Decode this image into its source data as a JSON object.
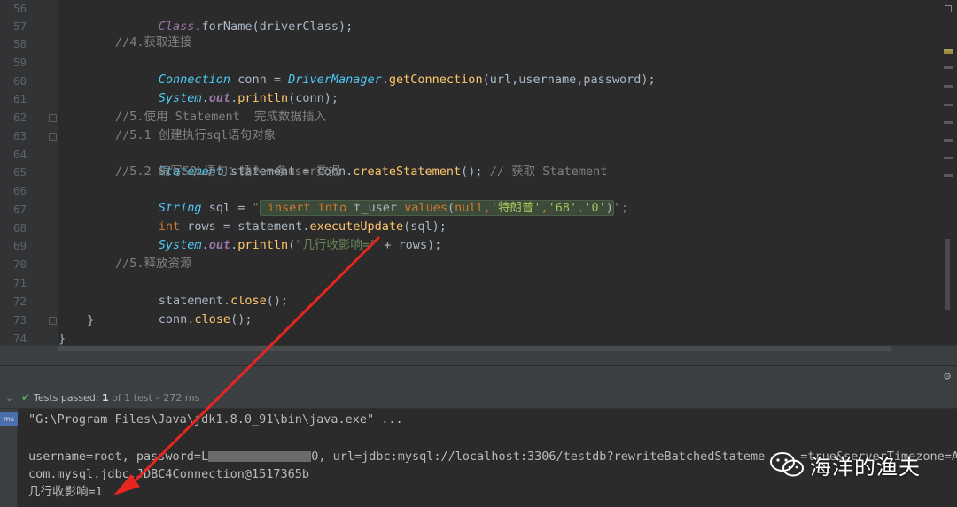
{
  "editor": {
    "line_numbers": [
      "56",
      "57",
      "58",
      "59",
      "60",
      "61",
      "62",
      "63",
      "64",
      "65",
      "66",
      "67",
      "68",
      "69",
      "70",
      "71",
      "72",
      "73",
      "74"
    ],
    "code": {
      "l56": {
        "cls": "Class",
        "rest": ".forName(driverClass);"
      },
      "l58": "//4.获取连接",
      "l59": {
        "type": "Connection",
        "var": " conn = ",
        "type2": "DriverManager",
        "dot": ".",
        "method": "getConnection",
        "args": "(url,username,password);"
      },
      "l60": {
        "cls": "System",
        "dot": ".",
        "field": "out",
        "dot2": ".",
        "method": "println",
        "args": "(conn);"
      },
      "l62": "//5.使用 Statement  完成数据插入",
      "l63": "//5.1 创建执行sql语句对象",
      "l64": {
        "type": "Statement",
        "var": " statement = conn.",
        "method": "createStatement",
        "args": "(); ",
        "comment": "// 获取 Statement"
      },
      "l65": "//5.2 编写SQL语句：插入一条user数据",
      "l66": {
        "type": "String",
        "var": " sql = ",
        "q1": "\"",
        "sql_kw1": " insert into",
        "sql_tbl": " t_user ",
        "sql_kw2": "values",
        "sql_open": "(",
        "sql_null": "null",
        "sql_comma": ",",
        "sql_v1": "'特朗普'",
        "sql_c2": ",",
        "sql_v2": "'68'",
        "sql_c3": ",",
        "sql_v3": "'0'",
        "sql_close": ")",
        "q2": "\";"
      },
      "l67": {
        "kw": "int",
        "var": " rows = statement.",
        "method": "executeUpdate",
        "args": "(sql);"
      },
      "l68": {
        "cls": "System",
        "dot": ".",
        "field": "out",
        "dot2": ".",
        "method": "println",
        "args_open": "(",
        "str": "\"几行收影响=\"",
        "args_rest": " + rows);"
      },
      "l70": "//5.释放资源",
      "l71": {
        "var": "statement.",
        "method": "close",
        "args": "();"
      },
      "l72": {
        "var": "conn.",
        "method": "close",
        "args": "();"
      },
      "l73": "}",
      "l74": "}"
    }
  },
  "run": {
    "status_label": "Tests passed:",
    "status_count": "1",
    "status_rest": "of 1 test – 272 ms",
    "badge": "ms"
  },
  "console": {
    "line1": "\"G:\\Program Files\\Java\\jdk1.8.0_91\\bin\\java.exe\" ...",
    "line2_a": "username=root, password=L",
    "line2_b": "0, url=jdbc:mysql://localhost:3306/testdb?rewriteBatchedStateme",
    "line2_c": "=true&serverTimezone=As",
    "line3_a": "com.mysql.jdbc.",
    "line3_b": "JDBC4Connection@1517365b",
    "line4": "几行收影响=1"
  },
  "watermark": {
    "text": "海洋的渔夫"
  },
  "colors": {
    "arrow": "#e8251f",
    "badge": "#4b6eaf",
    "test_pass": "#59a869"
  }
}
